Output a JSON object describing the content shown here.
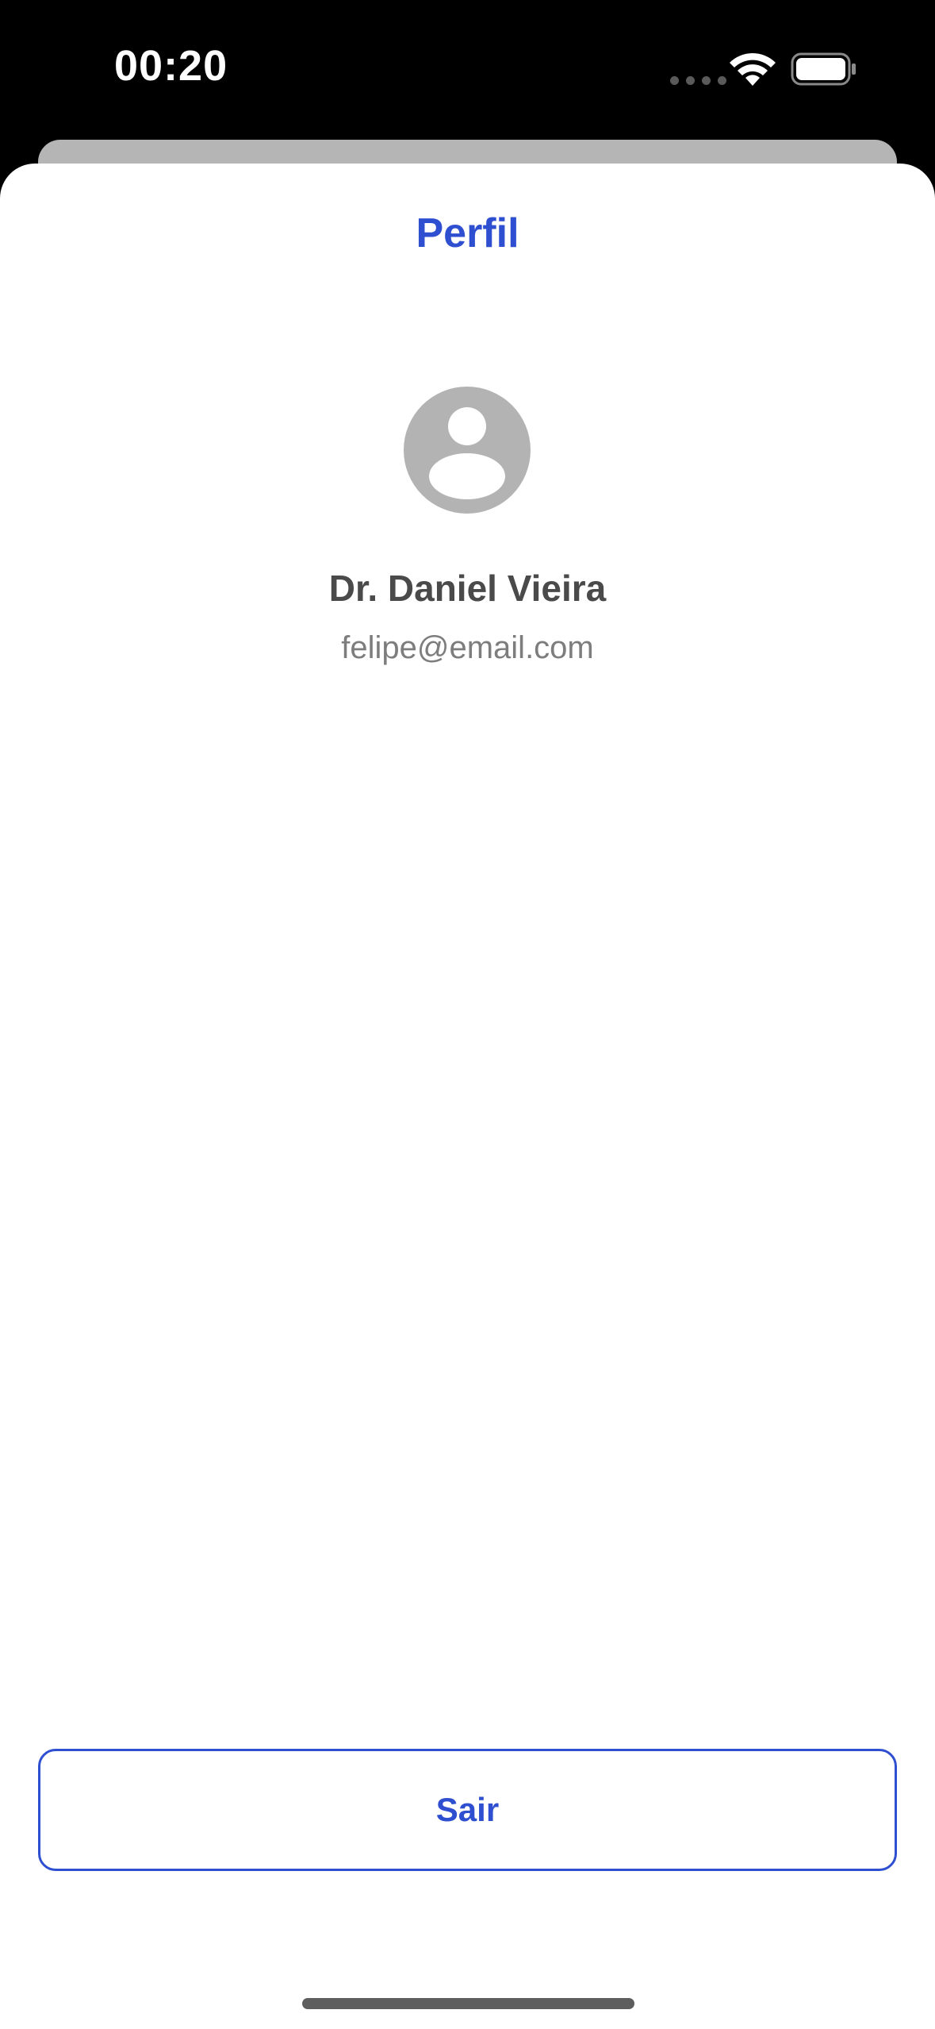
{
  "status_bar": {
    "time": "00:20",
    "wifi_icon": "wifi-icon",
    "battery_icon": "battery-icon",
    "signal_icon": "cellular-dots-icon"
  },
  "sheet": {
    "title": "Perfil"
  },
  "profile": {
    "avatar_icon": "user-avatar-icon",
    "name": "Dr. Daniel Vieira",
    "email": "felipe@email.com"
  },
  "actions": {
    "logout_label": "Sair"
  },
  "colors": {
    "accent": "#2f4fd1",
    "name_text": "#4a4a4a",
    "email_text": "#7d7d7d",
    "avatar_gray": "#b3b3b3",
    "status_bar_bg": "#000000"
  }
}
